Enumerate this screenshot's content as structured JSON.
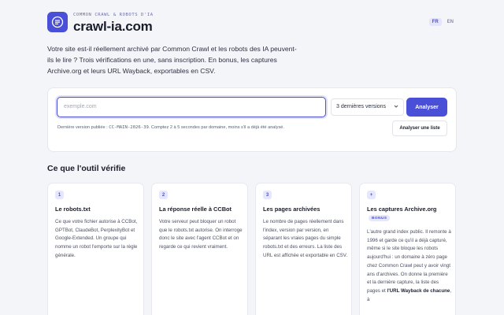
{
  "header": {
    "tagline": "COMMON CRAWL & ROBOTS D'IA",
    "site_name": "crawl-ia.com",
    "lang_fr": "FR",
    "lang_en": "EN",
    "logo_icon": "document-list-icon"
  },
  "intro": "Votre site est-il réellement archivé par Common Crawl et les robots des IA peuvent-ils le lire ? Trois vérifications en une, sans inscription. En bonus, les captures Archive.org et leurs URL Wayback, exportables en CSV.",
  "search": {
    "placeholder": "exemple.com",
    "select_value": "3 dernières versions",
    "analyse_label": "Analyser",
    "meta_prefix": "Dernière version publiée : ",
    "meta_version": "CC-MAIN-2026-39",
    "meta_suffix": ". Comptez 2 à 5 secondes par domaine, moins s'il a déjà été analysé.",
    "list_label": "Analyser une liste"
  },
  "section_title": "Ce que l'outil vérifie",
  "cards": [
    {
      "num": "1",
      "title": "Le robots.txt",
      "body": "Ce que votre fichier autorise à CCBot, GPTBot, ClaudeBot, PerplexityBot et Google-Extended. Un groupe qui nomme un robot l'emporte sur la règle générale."
    },
    {
      "num": "2",
      "title": "La réponse réelle à CCBot",
      "body": "Votre serveur peut bloquer un robot que le robots.txt autorise. On interroge donc le site avec l'agent CCBot et on regarde ce qui revient vraiment."
    },
    {
      "num": "3",
      "title": "Les pages archivées",
      "body": "Le nombre de pages réellement dans l'index, version par version, en séparant les vraies pages du simple robots.txt et des erreurs. La liste des URL est affichée et exportable en CSV."
    },
    {
      "num": "+",
      "title": "Les captures Archive.org",
      "badge": "BONUS",
      "body_1": "L'autre grand index public. Il remonte à 1996 et garde ce qu'il a déjà capturé, même si le site bloque les robots aujourd'hui : un domaine à zéro page chez Common Crawl peut y avoir vingt ans d'archives. On donne la première et la dernière capture, la liste des pages et ",
      "body_bold": "l'URL Wayback de chacune",
      "body_2": ", à"
    }
  ]
}
